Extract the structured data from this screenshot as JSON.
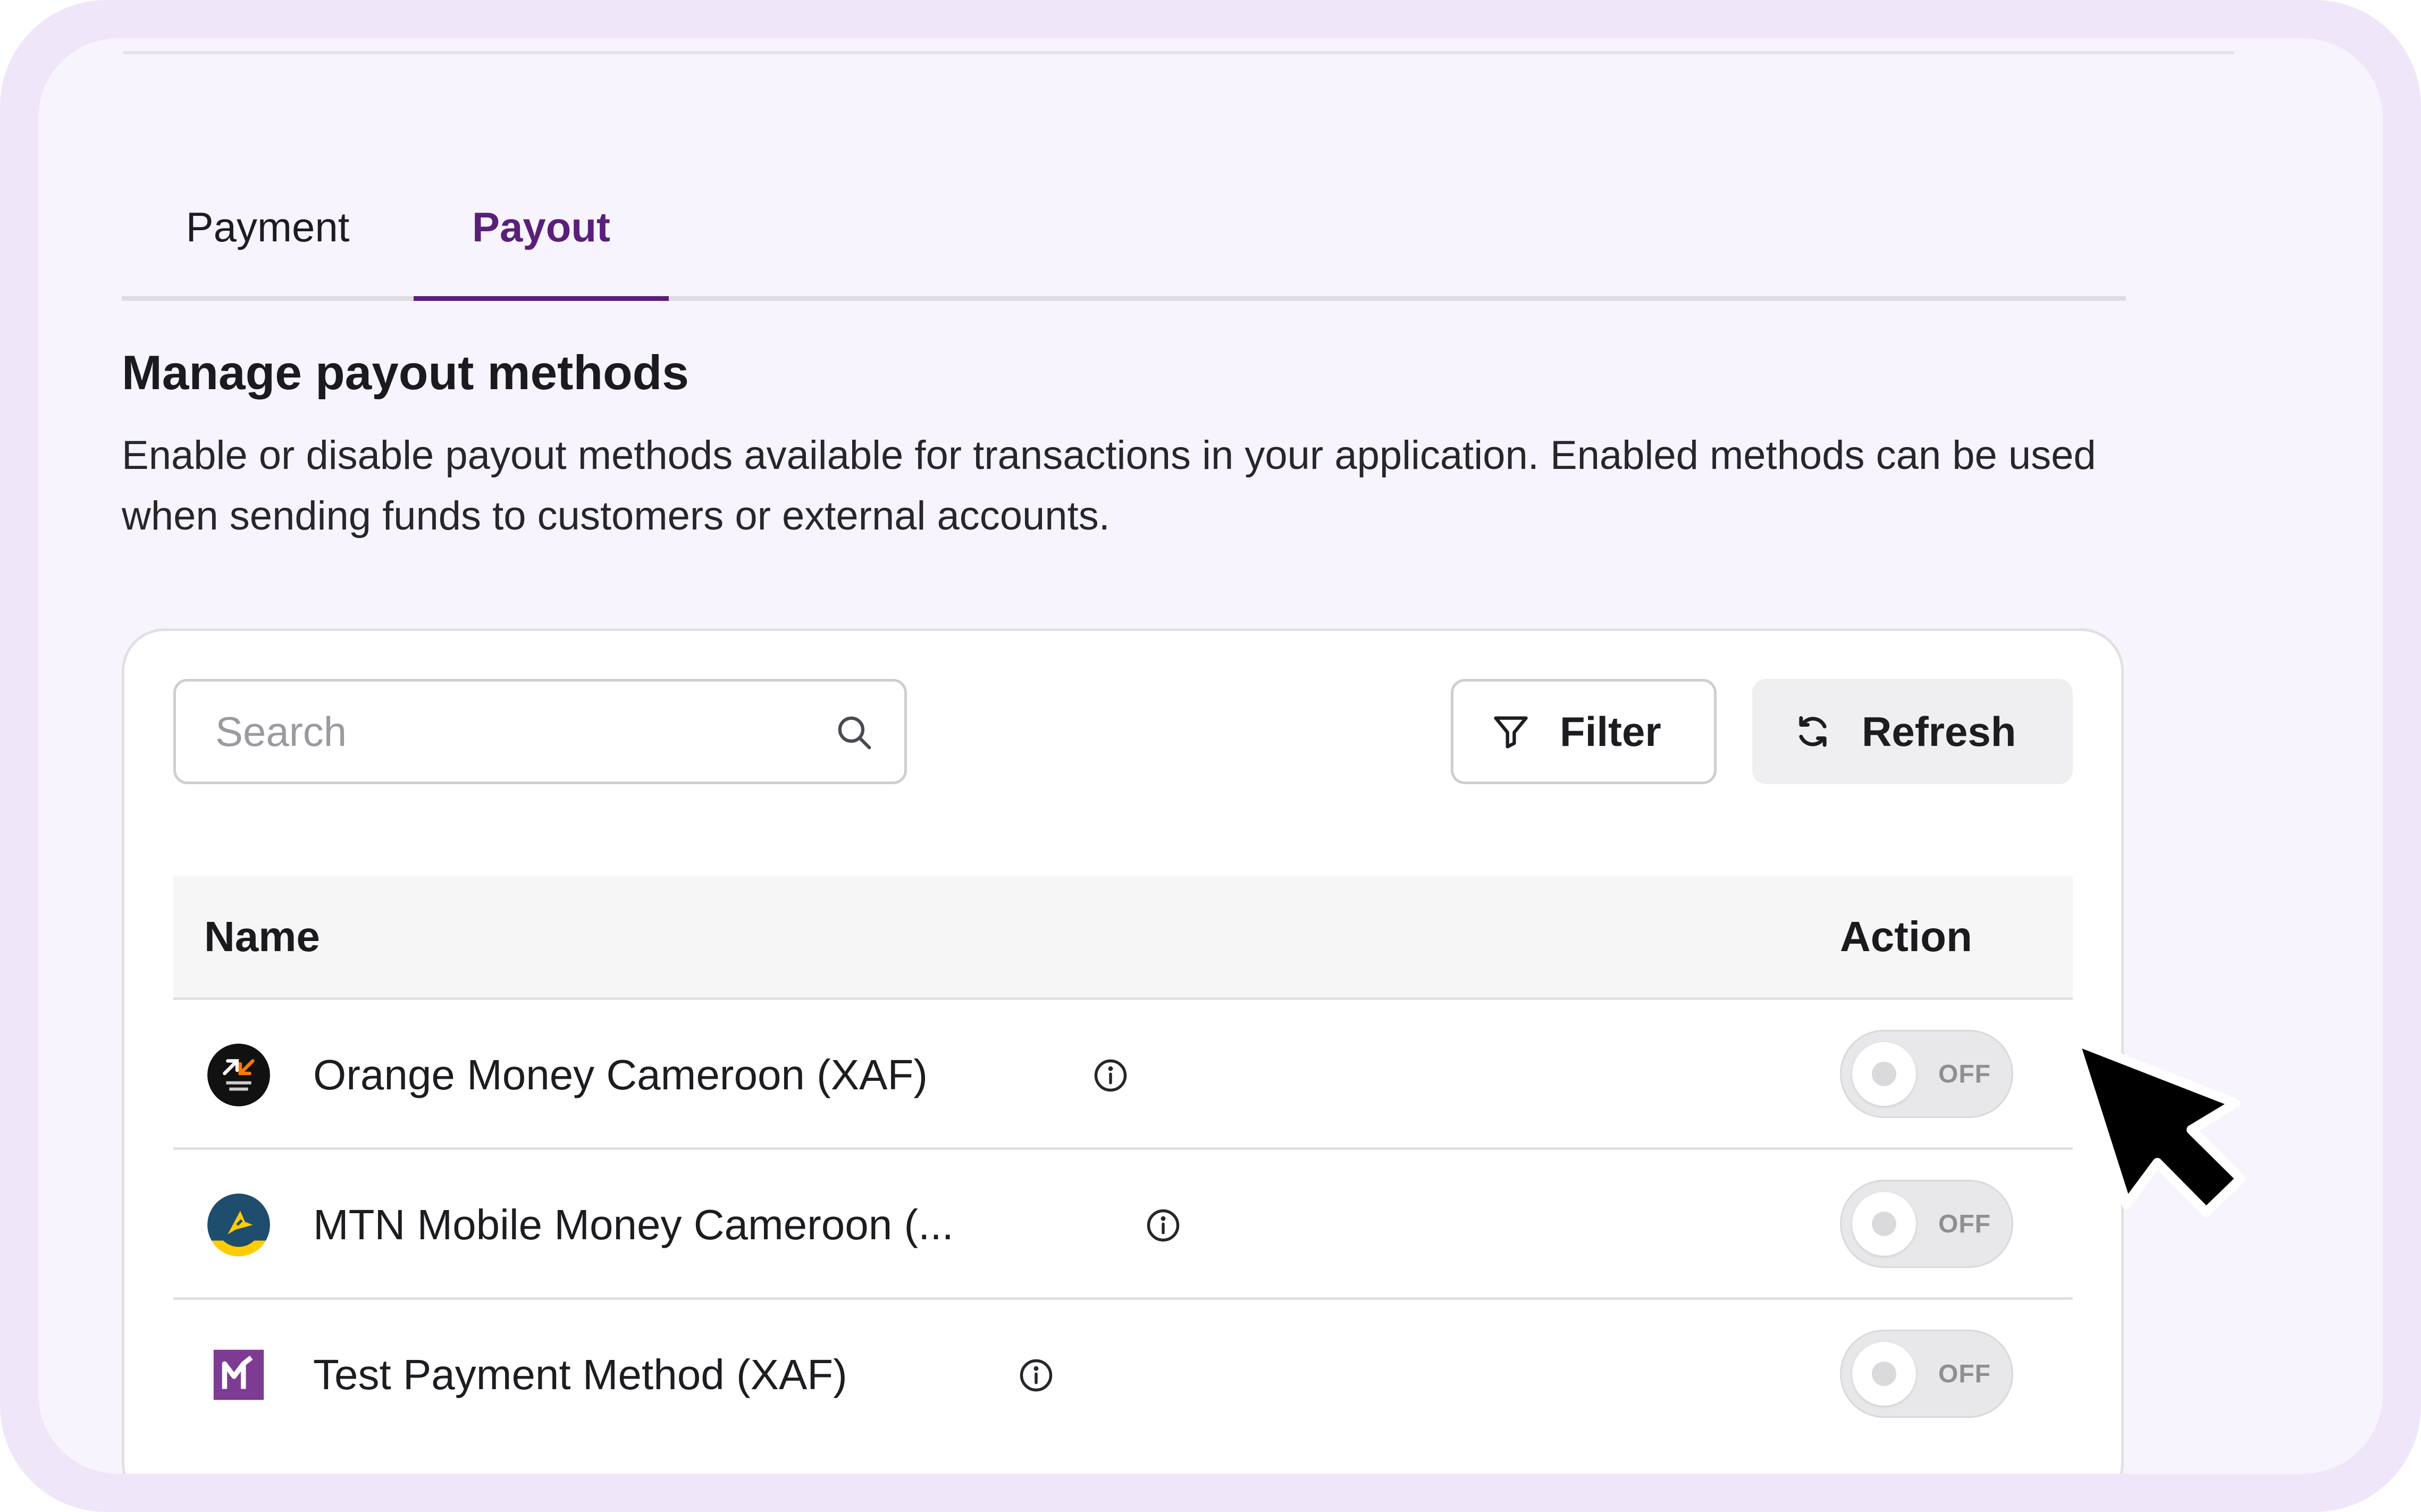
{
  "tabs": [
    {
      "label": "Payment",
      "active": false
    },
    {
      "label": "Payout",
      "active": true
    }
  ],
  "section": {
    "title": "Manage payout methods",
    "description": "Enable or disable payout methods available for transactions in your application. Enabled methods can be used when sending funds to customers or external accounts."
  },
  "toolbar": {
    "search_placeholder": "Search",
    "search_value": "",
    "filter_label": "Filter",
    "refresh_label": "Refresh"
  },
  "table": {
    "columns": [
      "Name",
      "Action"
    ],
    "rows": [
      {
        "name": "Orange Money Cameroon (XAF)",
        "toggle_label": "OFF",
        "enabled": false,
        "logo": "orange-money-logo"
      },
      {
        "name": "MTN Mobile Money Cameroon (...",
        "toggle_label": "OFF",
        "enabled": false,
        "logo": "mtn-mobile-money-logo"
      },
      {
        "name": "Test Payment Method (XAF)",
        "toggle_label": "OFF",
        "enabled": false,
        "logo": "test-method-logo"
      }
    ]
  },
  "colors": {
    "accent": "#5a1f7a",
    "page_background": "#f7f4fd",
    "frame": "#f0e6f9"
  }
}
